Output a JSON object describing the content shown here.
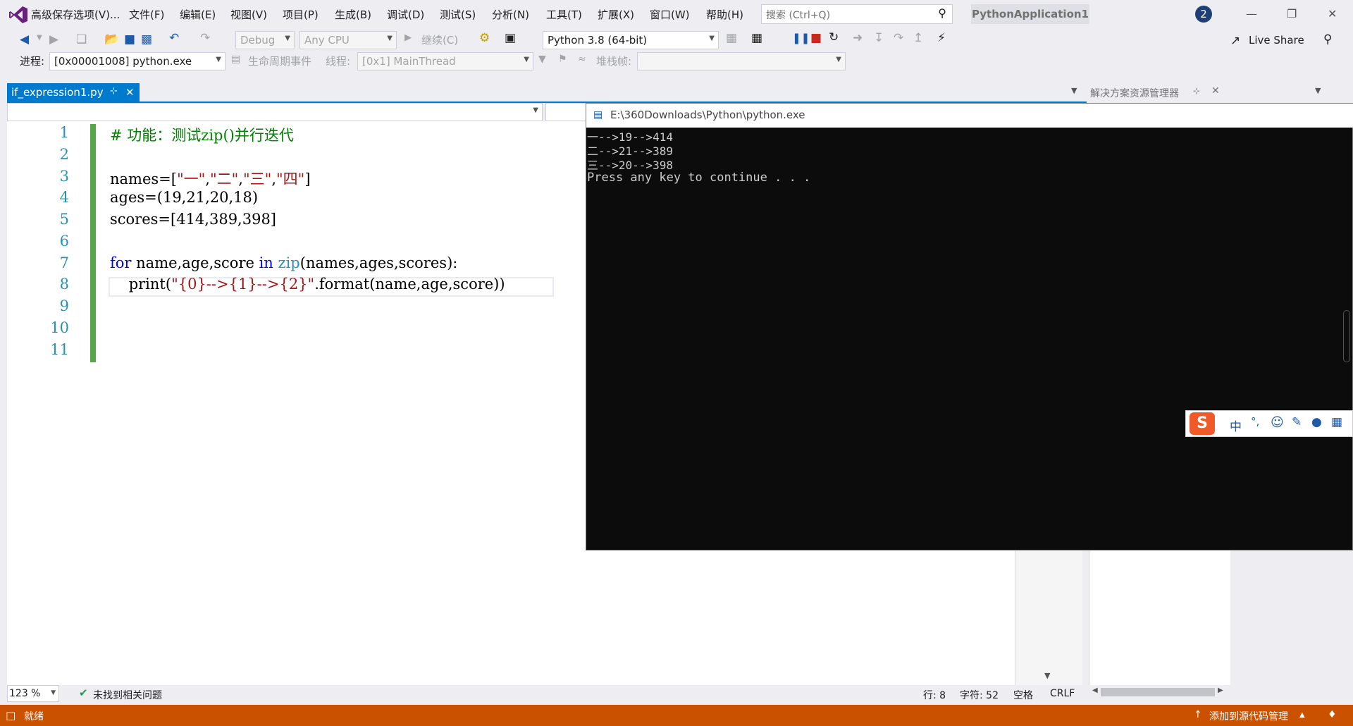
{
  "menu": {
    "items": [
      "高级保存选项(V)...",
      "文件(F)",
      "编辑(E)",
      "视图(V)",
      "项目(P)",
      "生成(B)",
      "调试(D)",
      "测试(S)",
      "分析(N)",
      "工具(T)",
      "扩展(X)",
      "窗口(W)",
      "帮助(H)"
    ],
    "search_placeholder": "搜索 (Ctrl+Q)",
    "app_title": "PythonApplication1",
    "notification_count": "2"
  },
  "toolbar": {
    "config": "Debug",
    "platform": "Any CPU",
    "continue_label": "继续(C)",
    "python_env": "Python 3.8 (64-bit)",
    "live_share": "Live Share"
  },
  "debug_toolbar": {
    "process_label": "进程:",
    "process_value": "[0x00001008] python.exe",
    "lifecycle_label": "生命周期事件",
    "thread_label": "线程:",
    "thread_value": "[0x1] MainThread",
    "stackframe_label": "堆栈帧:"
  },
  "tab": {
    "filename": "if_expression1.py"
  },
  "editor": {
    "line_numbers": [
      "1",
      "2",
      "3",
      "4",
      "5",
      "6",
      "7",
      "8",
      "9",
      "10",
      "11"
    ],
    "lines": {
      "l1_comment": "# 功能：测试zip()并行迭代",
      "l3_a": "names=[",
      "l3_s1": "\"一\"",
      "l3_s2": "\"二\"",
      "l3_s3": "\"三\"",
      "l3_s4": "\"四\"",
      "l3_end": "]",
      "l4": "ages=(19,21,20,18)",
      "l5": "scores=[414,389,398]",
      "l7_for": "for",
      "l7_mid": " name,age,score ",
      "l7_in": "in",
      "l7_zip": "zip",
      "l7_rest": "(names,ages,scores):",
      "l8_print": "    print(",
      "l8_str": "\"{0}-->{1}-->{2}\"",
      "l8_rest": ".format(name,age,score))"
    }
  },
  "console": {
    "title": "E:\\360Downloads\\Python\\python.exe",
    "output": [
      "一-->19-->414",
      "二-->21-->389",
      "三-->20-->398",
      "Press any key to continue . . ."
    ]
  },
  "solution_explorer": {
    "title": "解决方案资源管理器"
  },
  "editor_status": {
    "zoom": "123 %",
    "issues": "未找到相关问题",
    "line": "行: 8",
    "char": "字符: 52",
    "space": "空格",
    "eol": "CRLF"
  },
  "statusbar": {
    "ready": "就绪",
    "source_control": "添加到源代码管理"
  },
  "ime": {
    "lang": "中"
  }
}
